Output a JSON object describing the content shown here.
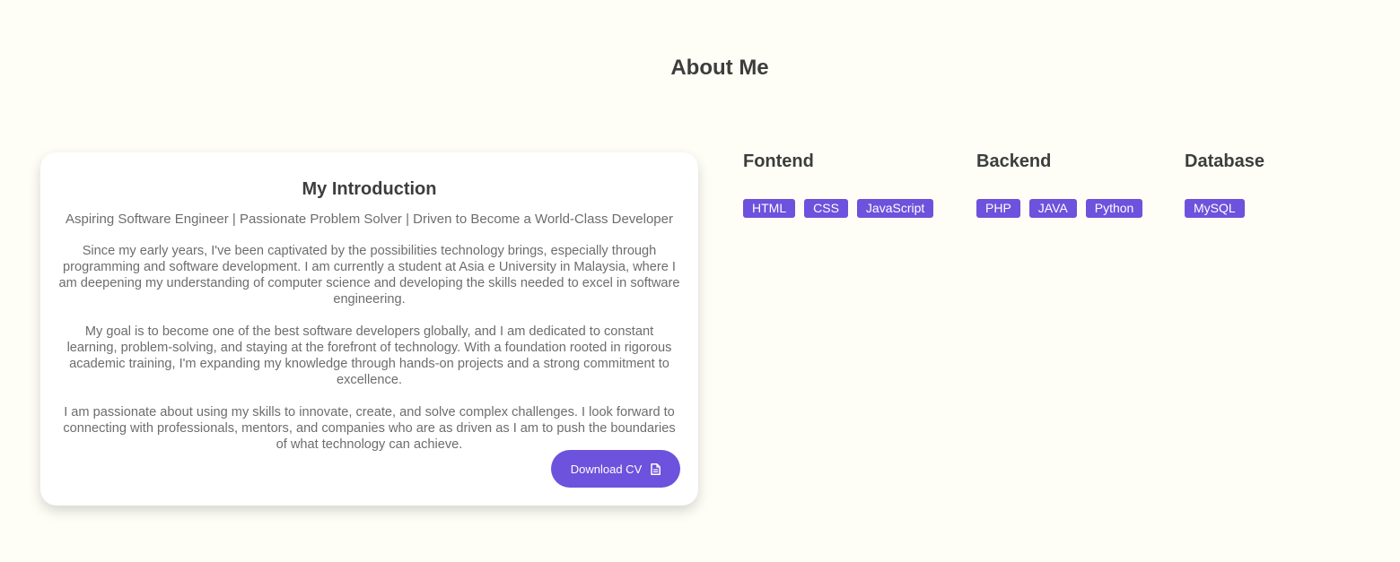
{
  "page": {
    "title": "About Me"
  },
  "intro": {
    "title": "My Introduction",
    "subtitle": "Aspiring Software Engineer | Passionate Problem Solver | Driven to Become a World-Class Developer",
    "paragraphs": [
      "Since my early years, I've been captivated by the possibilities technology brings, especially through programming and software development. I am currently a student at Asia e University in Malaysia, where I am deepening my understanding of computer science and developing the skills needed to excel in software engineering.",
      "My goal is to become one of the best software developers globally, and I am dedicated to constant learning, problem-solving, and staying at the forefront of technology. With a foundation rooted in rigorous academic training, I'm expanding my knowledge through hands-on projects and a strong commitment to excellence.",
      "I am passionate about using my skills to innovate, create, and solve complex challenges. I look forward to connecting with professionals, mentors, and companies who are as driven as I am to push the boundaries of what technology can achieve."
    ],
    "download_label": "Download CV",
    "download_icon": "document-icon"
  },
  "skills": {
    "frontend": {
      "heading": "Fontend",
      "tags": [
        "HTML",
        "CSS",
        "JavaScript"
      ]
    },
    "backend": {
      "heading": "Backend",
      "tags": [
        "PHP",
        "JAVA",
        "Python"
      ]
    },
    "database": {
      "heading": "Database",
      "tags": [
        "MySQL"
      ]
    }
  },
  "colors": {
    "accent": "#6c52dc",
    "background": "#fefef7",
    "text": "#3d3d3d",
    "muted_text": "#6d6d6d"
  }
}
